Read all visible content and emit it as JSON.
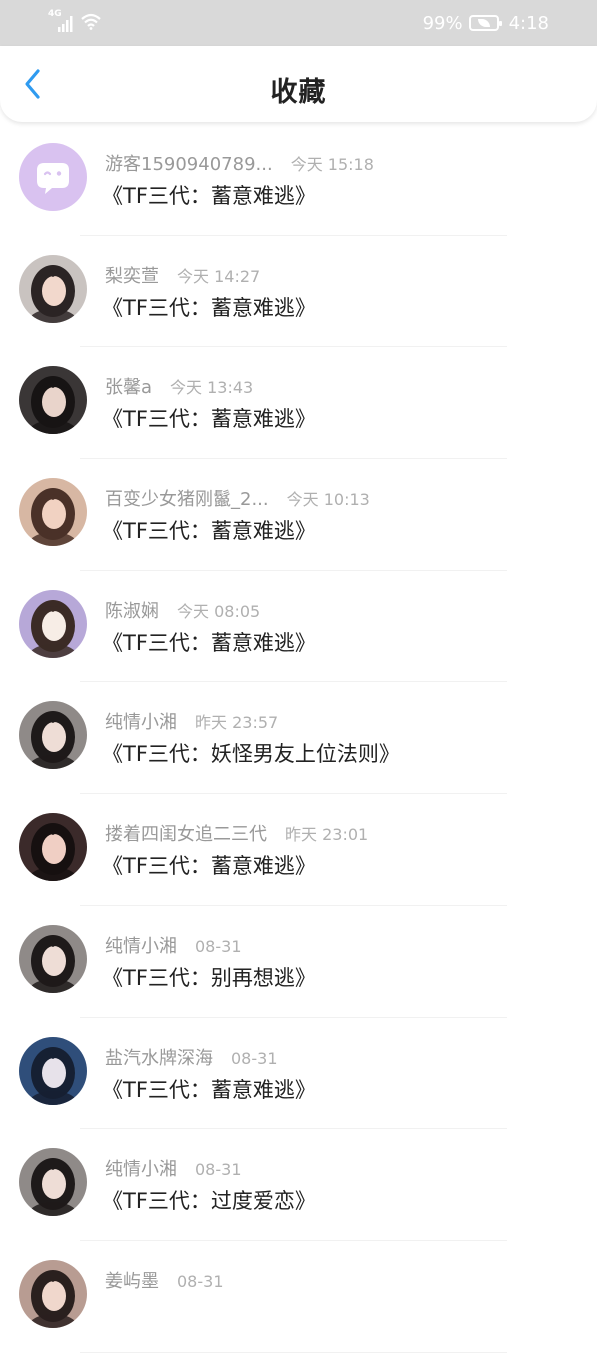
{
  "status_bar": {
    "network": "4G",
    "battery": "99%",
    "time": "4:18"
  },
  "nav": {
    "title": "收藏",
    "back_icon": "chevron-left-icon"
  },
  "colors": {
    "accent": "#2f9bf0",
    "status_bar_bg": "#d9d9d9"
  },
  "items": [
    {
      "name": "游客1590940789...",
      "time": "今天 15:18",
      "title": "《TF三代：蓄意难逃》",
      "avatar": {
        "type": "guest",
        "bg": "#d9c2f0"
      }
    },
    {
      "name": "梨奕萱",
      "time": "今天 14:27",
      "title": "《TF三代：蓄意难逃》",
      "avatar": {
        "type": "photo",
        "bg": "#c9c3c0",
        "hair": "#2b2424",
        "face": "#f2d8cc"
      }
    },
    {
      "name": "张馨a",
      "time": "今天 13:43",
      "title": "《TF三代：蓄意难逃》",
      "avatar": {
        "type": "photo",
        "bg": "#3a3636",
        "hair": "#171414",
        "face": "#e9d4cb"
      }
    },
    {
      "name": "百变少女猪刚鬣_2...",
      "time": "今天 10:13",
      "title": "《TF三代：蓄意难逃》",
      "avatar": {
        "type": "photo",
        "bg": "#d7b7a3",
        "hair": "#4a3128",
        "face": "#f1d2c2"
      }
    },
    {
      "name": "陈淑娴",
      "time": "今天 08:05",
      "title": "《TF三代：蓄意难逃》",
      "avatar": {
        "type": "photo",
        "bg": "#b7a8d8",
        "hair": "#3b2b26",
        "face": "#f7ede6"
      }
    },
    {
      "name": "纯情小湘",
      "time": "昨天 23:57",
      "title": "《TF三代：妖怪男友上位法则》",
      "avatar": {
        "type": "photo",
        "bg": "#8f8a88",
        "hair": "#1e1a1a",
        "face": "#eeddd6"
      }
    },
    {
      "name": "搂着四闺女追二三代",
      "time": "昨天 23:01",
      "title": "《TF三代：蓄意难逃》",
      "avatar": {
        "type": "photo",
        "bg": "#3b2a2a",
        "hair": "#161010",
        "face": "#f0cfc4"
      }
    },
    {
      "name": "纯情小湘",
      "time": "08-31",
      "title": "《TF三代：别再想逃》",
      "avatar": {
        "type": "photo",
        "bg": "#8f8a88",
        "hair": "#1e1a1a",
        "face": "#eeddd6"
      }
    },
    {
      "name": "盐汽水牌深海",
      "time": "08-31",
      "title": "《TF三代：蓄意难逃》",
      "avatar": {
        "type": "photo",
        "bg": "#2f4e7a",
        "hair": "#162033",
        "face": "#e7e2ea"
      }
    },
    {
      "name": "纯情小湘",
      "time": "08-31",
      "title": "《TF三代：过度爱恋》",
      "avatar": {
        "type": "photo",
        "bg": "#8f8a88",
        "hair": "#1e1a1a",
        "face": "#eeddd6"
      }
    },
    {
      "name": "姜屿墨",
      "time": "08-31",
      "title": "",
      "avatar": {
        "type": "photo",
        "bg": "#b89c92",
        "hair": "#2a201e",
        "face": "#f0d7cc"
      }
    }
  ]
}
